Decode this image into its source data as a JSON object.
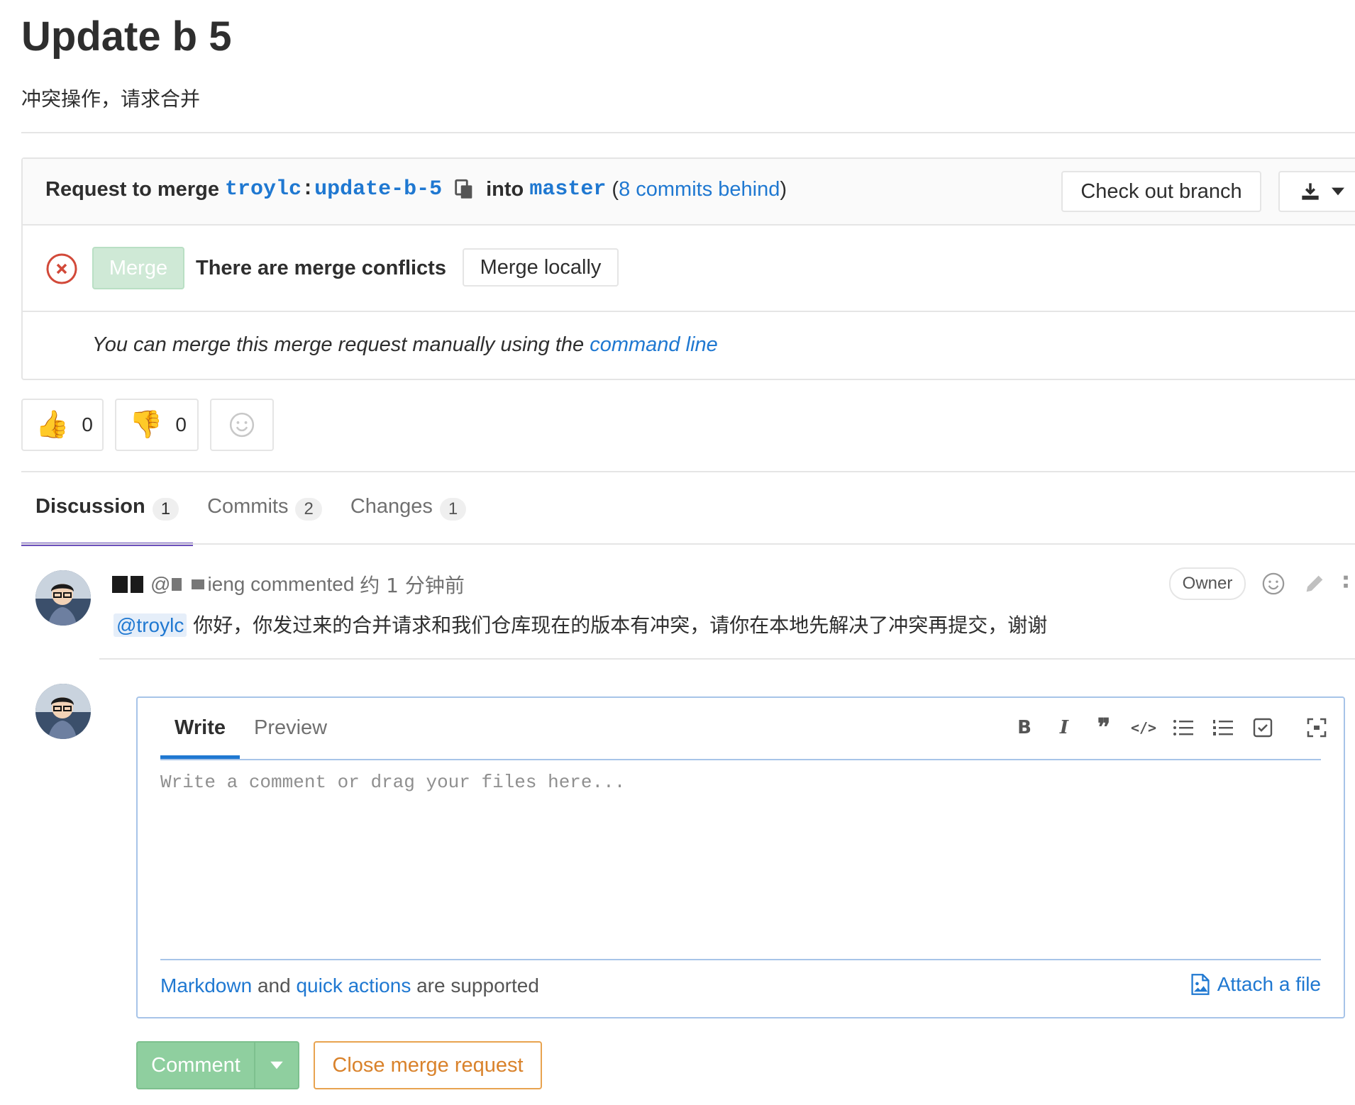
{
  "page": {
    "title": "Update b 5",
    "description": "冲突操作，请求合并"
  },
  "merge_widget": {
    "request_prefix": "Request to merge",
    "source_namespace": "troylc",
    "source_sep": ":",
    "source_branch": "update-b-5",
    "into_word": "into",
    "target_branch": "master",
    "paren_open": "(",
    "behind_text": "8 commits behind",
    "paren_close": ")",
    "checkout_label": "Check out branch",
    "merge_label": "Merge",
    "conflict_text": "There are merge conflicts",
    "merge_locally_label": "Merge locally",
    "manual_text": "You can merge this merge request manually using the",
    "command_line_link": "command line"
  },
  "awards": {
    "thumbs_up_count": "0",
    "thumbs_down_count": "0"
  },
  "tabs": [
    {
      "label": "Discussion",
      "count": "1"
    },
    {
      "label": "Commits",
      "count": "2"
    },
    {
      "label": "Changes",
      "count": "1"
    }
  ],
  "note": {
    "author_suffix": "@",
    "handle_suffix": "ieng",
    "action": "commented",
    "time": "约 1 分钟前",
    "role": "Owner",
    "mention": "@troylc",
    "body": "你好，你发过来的合并请求和我们仓库现在的版本有冲突，请你在本地先解决了冲突再提交，谢谢"
  },
  "comment_form": {
    "write_tab": "Write",
    "preview_tab": "Preview",
    "placeholder": "Write a comment or drag your files here...",
    "markdown_link": "Markdown",
    "and_text": "and",
    "quick_actions_link": "quick actions",
    "supported_text": "are supported",
    "attach_label": "Attach a file",
    "toolbar_icons": [
      "bold-icon",
      "italic-icon",
      "quote-icon",
      "code-icon",
      "bullet-list-icon",
      "numbered-list-icon",
      "task-list-icon",
      "fullscreen-icon"
    ]
  },
  "actions": {
    "comment_label": "Comment",
    "close_label": "Close merge request"
  },
  "colors": {
    "link": "#1f78d1",
    "active_tab": "#6b4fbb",
    "merge_disabled": "#cfe9d6",
    "comment_btn": "#8fcf9f",
    "close_btn": "#d9822b",
    "error": "#d24939"
  }
}
